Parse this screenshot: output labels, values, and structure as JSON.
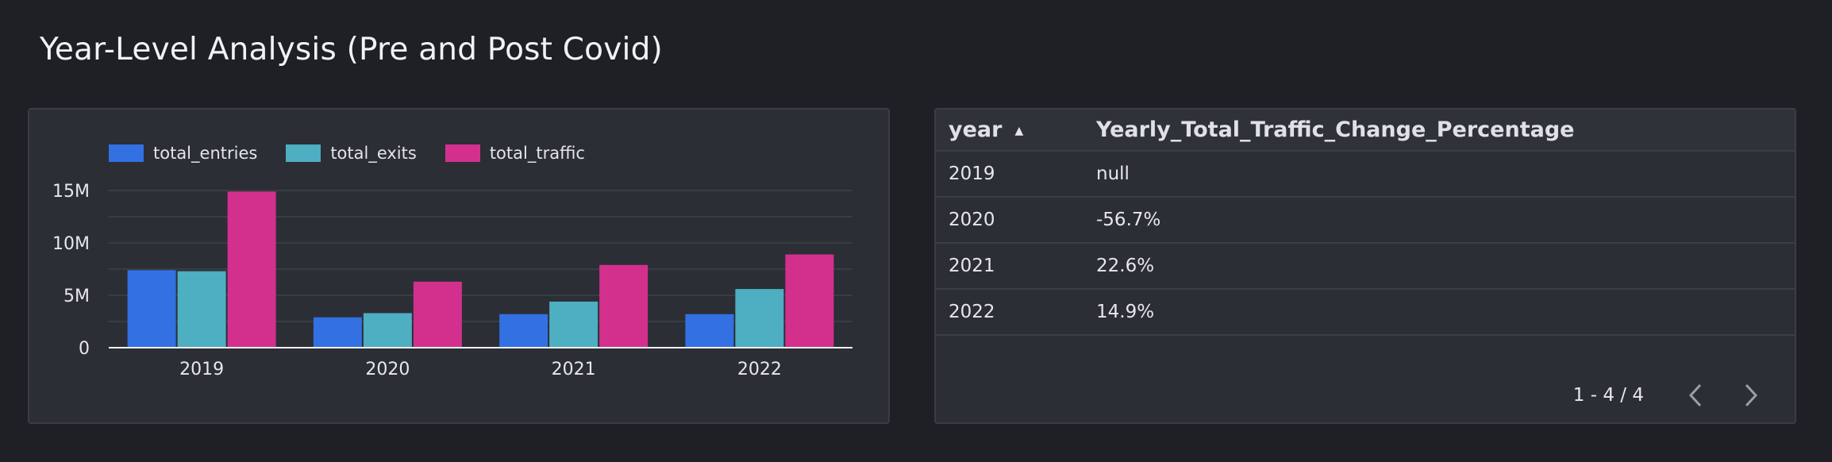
{
  "page": {
    "title": "Year-Level Analysis (Pre and Post Covid)"
  },
  "colors": {
    "entries": "#3370e2",
    "exits": "#4eaec2",
    "traffic": "#d3308e",
    "grid": "#3d4048",
    "axis": "#e6e8eb"
  },
  "chart_data": {
    "type": "bar",
    "categories": [
      "2019",
      "2020",
      "2021",
      "2022"
    ],
    "series": [
      {
        "name": "total_entries",
        "values": [
          7.4,
          2.9,
          3.2,
          3.2
        ]
      },
      {
        "name": "total_exits",
        "values": [
          7.3,
          3.3,
          4.4,
          5.6
        ]
      },
      {
        "name": "total_traffic",
        "values": [
          14.9,
          6.3,
          7.9,
          8.9
        ]
      }
    ],
    "value_unit": "M",
    "yticks": [
      "0",
      "5M",
      "10M",
      "15M"
    ],
    "ytick_values": [
      0,
      5,
      10,
      15
    ],
    "ylim": [
      0,
      15
    ],
    "grid": true,
    "legend": "top-left"
  },
  "table": {
    "columns": [
      "year",
      "Yearly_Total_Traffic_Change_Percentage"
    ],
    "rows": [
      [
        "2019",
        "null"
      ],
      [
        "2020",
        "-56.7%"
      ],
      [
        "2021",
        "22.6%"
      ],
      [
        "2022",
        "14.9%"
      ]
    ],
    "sort_icon": "sort-ascending-icon",
    "pager_text": "1 - 4 / 4"
  }
}
